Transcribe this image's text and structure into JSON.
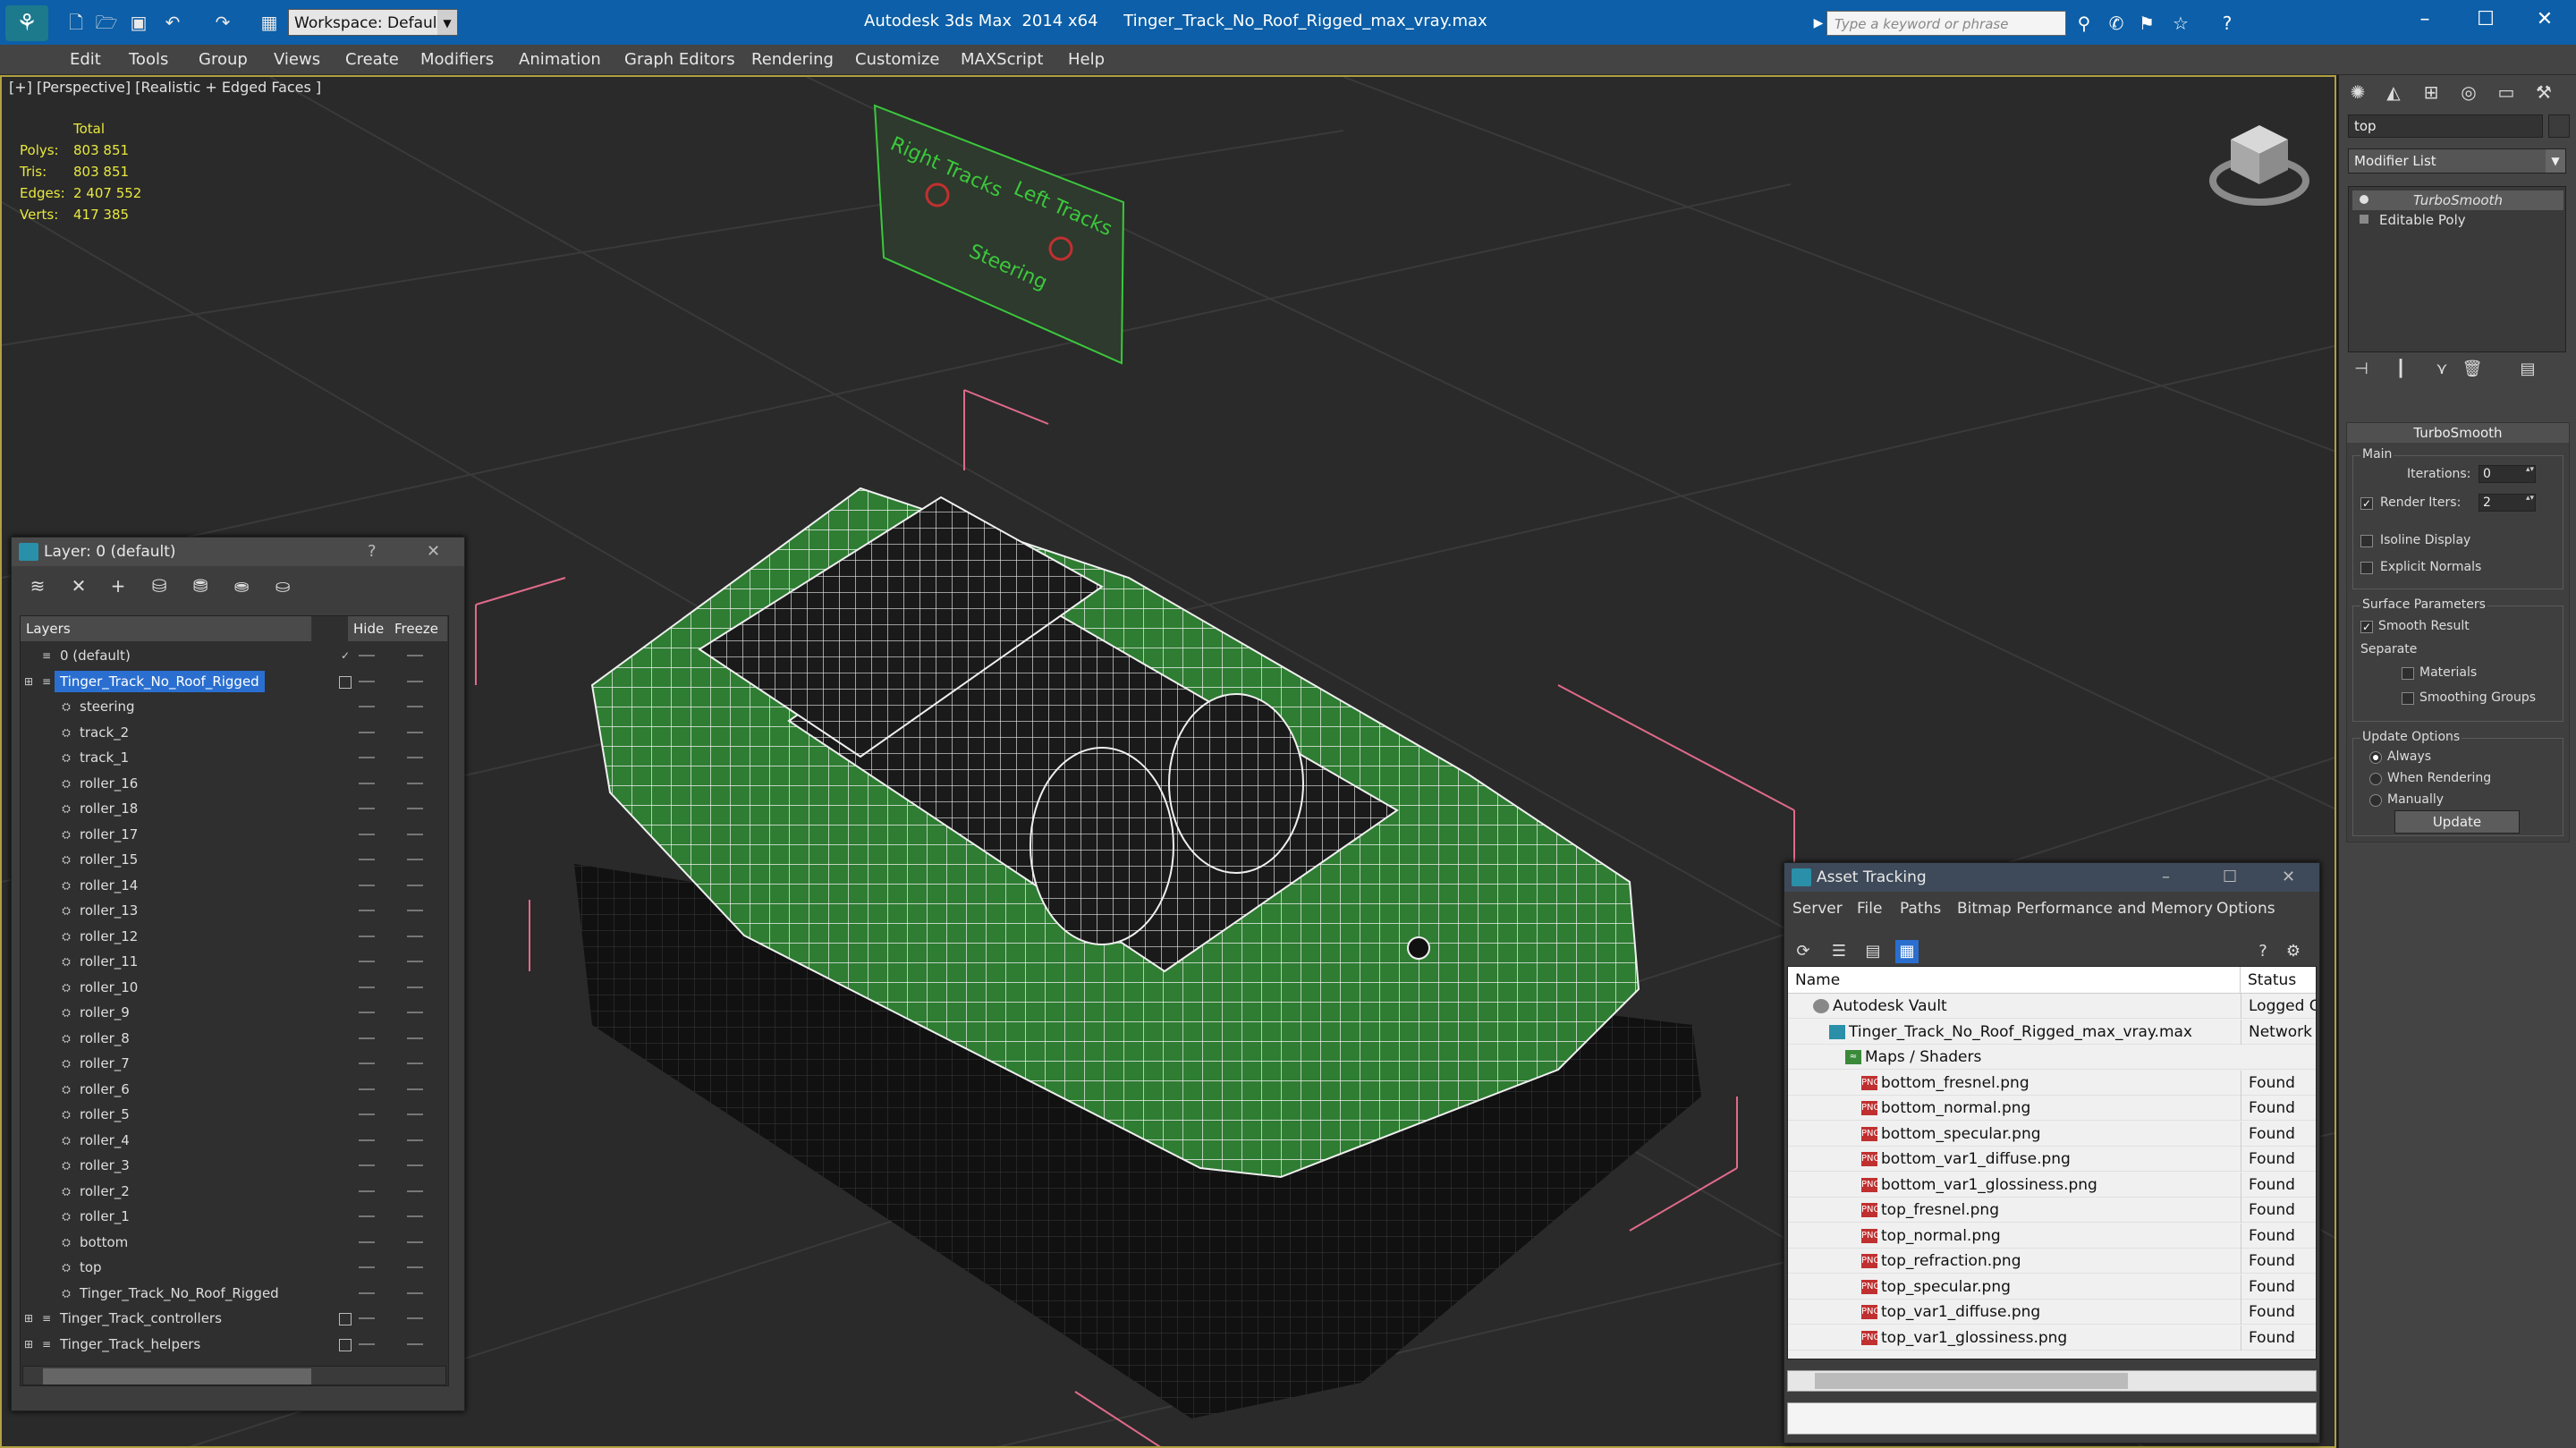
{
  "app": {
    "title": "Autodesk 3ds Max  2014 x64     Tinger_Track_No_Roof_Rigged_max_vray.max",
    "workspace": "Workspace: Default",
    "search_placeholder": "Type a keyword or phrase"
  },
  "menu": [
    "Edit",
    "Tools",
    "Group",
    "Views",
    "Create",
    "Modifiers",
    "Animation",
    "Graph Editors",
    "Rendering",
    "Customize",
    "MAXScript",
    "Help"
  ],
  "viewport": {
    "label": "[+] [Perspective] [Realistic + Edged Faces ]",
    "stats": {
      "header": "Total",
      "rows": [
        {
          "label": "Polys:",
          "value": "803 851"
        },
        {
          "label": "Tris:",
          "value": "803 851"
        },
        {
          "label": "Edges:",
          "value": "2 407 552"
        },
        {
          "label": "Verts:",
          "value": "417 385"
        }
      ]
    },
    "sign": {
      "right_tracks": "Right Tracks",
      "left_tracks": "Left Tracks",
      "steering": "Steering"
    }
  },
  "command_panel": {
    "object_name": "top",
    "modifier_list": "Modifier List",
    "stack": [
      "TurboSmooth",
      "Editable Poly"
    ],
    "turbosmooth": {
      "header": "TurboSmooth",
      "main_label": "Main",
      "iterations_label": "Iterations:",
      "iterations_value": "0",
      "render_iters_label": "Render Iters:",
      "render_iters_value": "2",
      "isoline": "Isoline Display",
      "explicit_normals": "Explicit Normals",
      "surface_params": "Surface Parameters",
      "smooth_result": "Smooth Result",
      "separate": "Separate",
      "materials": "Materials",
      "smoothing_groups": "Smoothing Groups",
      "update_options": "Update Options",
      "always": "Always",
      "when_rendering": "When Rendering",
      "manually": "Manually",
      "update_button": "Update"
    }
  },
  "layer_panel": {
    "title": "Layer: 0 (default)",
    "help": "?",
    "close": "✕",
    "columns": {
      "layers": "Layers",
      "hide": "Hide",
      "freeze": "Freeze"
    },
    "rows": [
      {
        "name": "0 (default)",
        "level": 1
      },
      {
        "name": "Tinger_Track_No_Roof_Rigged",
        "level": 1,
        "selected": true
      },
      {
        "name": "steering",
        "level": 2
      },
      {
        "name": "track_2",
        "level": 2
      },
      {
        "name": "track_1",
        "level": 2
      },
      {
        "name": "roller_16",
        "level": 2
      },
      {
        "name": "roller_18",
        "level": 2
      },
      {
        "name": "roller_17",
        "level": 2
      },
      {
        "name": "roller_15",
        "level": 2
      },
      {
        "name": "roller_14",
        "level": 2
      },
      {
        "name": "roller_13",
        "level": 2
      },
      {
        "name": "roller_12",
        "level": 2
      },
      {
        "name": "roller_11",
        "level": 2
      },
      {
        "name": "roller_10",
        "level": 2
      },
      {
        "name": "roller_9",
        "level": 2
      },
      {
        "name": "roller_8",
        "level": 2
      },
      {
        "name": "roller_7",
        "level": 2
      },
      {
        "name": "roller_6",
        "level": 2
      },
      {
        "name": "roller_5",
        "level": 2
      },
      {
        "name": "roller_4",
        "level": 2
      },
      {
        "name": "roller_3",
        "level": 2
      },
      {
        "name": "roller_2",
        "level": 2
      },
      {
        "name": "roller_1",
        "level": 2
      },
      {
        "name": "bottom",
        "level": 2
      },
      {
        "name": "top",
        "level": 2
      },
      {
        "name": "Tinger_Track_No_Roof_Rigged",
        "level": 2
      },
      {
        "name": "Tinger_Track_controllers",
        "level": 1
      },
      {
        "name": "Tinger_Track_helpers",
        "level": 1
      }
    ]
  },
  "asset_tracking": {
    "title": "Asset Tracking",
    "menu": [
      "Server",
      "File",
      "Paths",
      "Bitmap Performance and Memory",
      "Options"
    ],
    "columns": {
      "name": "Name",
      "status": "Status"
    },
    "rows": [
      {
        "name": "Autodesk Vault",
        "status": "Logged Out",
        "indent": 1,
        "icon": "vault"
      },
      {
        "name": "Tinger_Track_No_Roof_Rigged_max_vray.max",
        "status": "Network Path",
        "indent": 2,
        "icon": "max"
      },
      {
        "name": "Maps / Shaders",
        "status": "",
        "indent": 3,
        "icon": "map"
      },
      {
        "name": "bottom_fresnel.png",
        "status": "Found",
        "indent": 4,
        "icon": "png"
      },
      {
        "name": "bottom_normal.png",
        "status": "Found",
        "indent": 4,
        "icon": "png"
      },
      {
        "name": "bottom_specular.png",
        "status": "Found",
        "indent": 4,
        "icon": "png"
      },
      {
        "name": "bottom_var1_diffuse.png",
        "status": "Found",
        "indent": 4,
        "icon": "png"
      },
      {
        "name": "bottom_var1_glossiness.png",
        "status": "Found",
        "indent": 4,
        "icon": "png"
      },
      {
        "name": "top_fresnel.png",
        "status": "Found",
        "indent": 4,
        "icon": "png"
      },
      {
        "name": "top_normal.png",
        "status": "Found",
        "indent": 4,
        "icon": "png"
      },
      {
        "name": "top_refraction.png",
        "status": "Found",
        "indent": 4,
        "icon": "png"
      },
      {
        "name": "top_specular.png",
        "status": "Found",
        "indent": 4,
        "icon": "png"
      },
      {
        "name": "top_var1_diffuse.png",
        "status": "Found",
        "indent": 4,
        "icon": "png"
      },
      {
        "name": "top_var1_glossiness.png",
        "status": "Found",
        "indent": 4,
        "icon": "png"
      }
    ]
  },
  "colors": {
    "accent": "#0c5fa8",
    "wire_green": "#2e7d32",
    "selection": "#2a6fd0",
    "bbox_pink": "#e06a8a"
  }
}
